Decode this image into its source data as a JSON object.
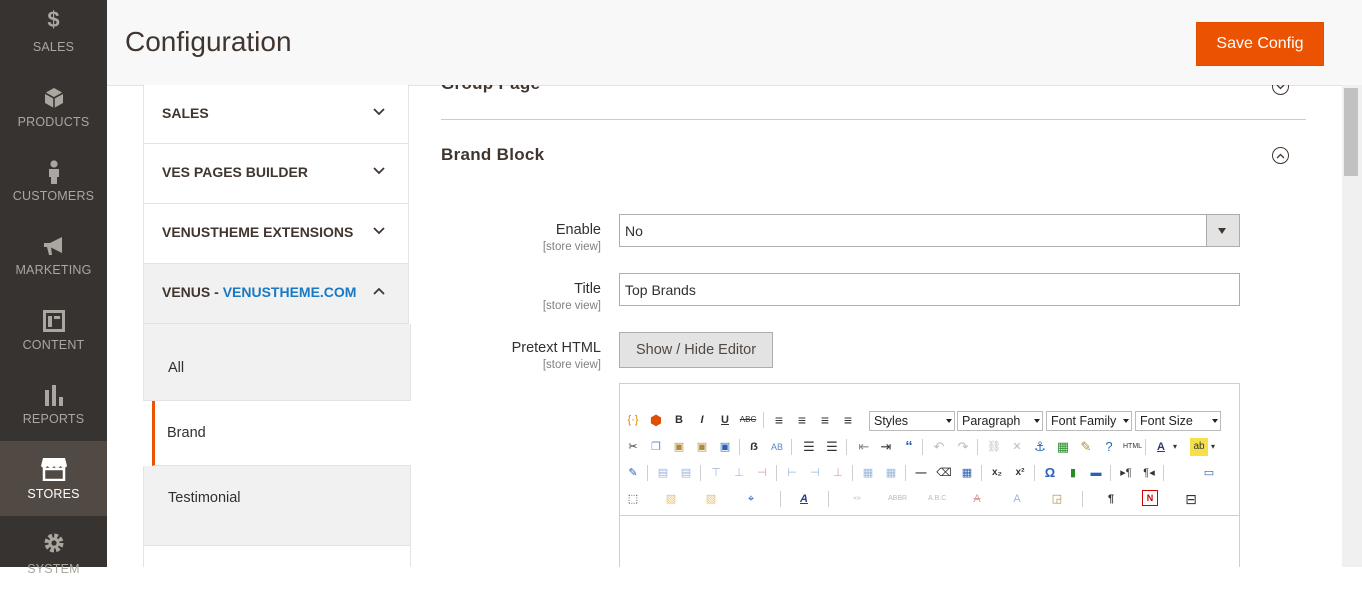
{
  "nav": {
    "items": [
      {
        "label": "SALES",
        "icon": "dollar-icon"
      },
      {
        "label": "PRODUCTS",
        "icon": "cube-icon"
      },
      {
        "label": "CUSTOMERS",
        "icon": "person-icon"
      },
      {
        "label": "MARKETING",
        "icon": "megaphone-icon"
      },
      {
        "label": "CONTENT",
        "icon": "layout-icon"
      },
      {
        "label": "REPORTS",
        "icon": "bar-chart-icon"
      },
      {
        "label": "STORES",
        "icon": "store-icon"
      },
      {
        "label": "SYSTEM",
        "icon": "gear-icon"
      }
    ]
  },
  "header": {
    "title": "Configuration",
    "save_label": "Save Config",
    "accent": "#eb5202"
  },
  "tabs": {
    "sales": "SALES",
    "ves_pages": "VES PAGES BUILDER",
    "venustheme_ext": "VENUSTHEME EXTENSIONS",
    "venus_prefix": "VENUS - ",
    "venus_link": "VENUSTHEME.COM",
    "sub": [
      "All",
      "Brand",
      "Testimonial"
    ]
  },
  "main": {
    "group_page": "Group Page",
    "brand_block": "Brand Block",
    "fields": {
      "enable_label": "Enable",
      "enable_scope": "[store view]",
      "enable_value": "No",
      "title_label": "Title",
      "title_scope": "[store view]",
      "title_value": "Top Brands",
      "pretext_label": "Pretext HTML",
      "pretext_scope": "[store view]",
      "editor_button": "Show / Hide Editor"
    },
    "editor": {
      "styles": "Styles",
      "paragraph": "Paragraph",
      "font_family": "Font Family",
      "font_size": "Font Size"
    }
  }
}
